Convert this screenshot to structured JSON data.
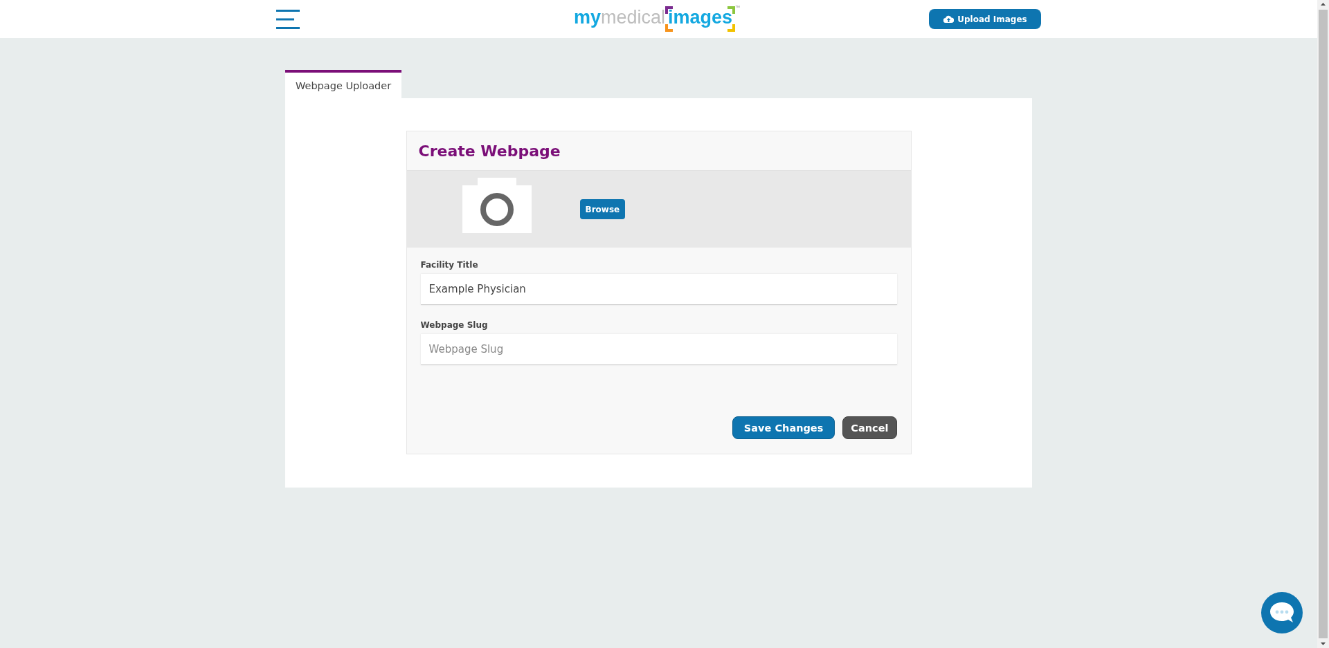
{
  "header": {
    "logo": {
      "parts": [
        "my",
        "medical",
        "images"
      ],
      "trademark": "™"
    },
    "upload_button": "Upload Images"
  },
  "tabs": [
    {
      "label": "Webpage Uploader",
      "selected": true
    }
  ],
  "card": {
    "title": "Create Webpage",
    "browse_button": "Browse",
    "fields": [
      {
        "label": "Facility Title",
        "value": "Example Physician"
      },
      {
        "label": "Webpage Slug",
        "placeholder": "Webpage Slug"
      }
    ],
    "buttons": [
      {
        "label": "Save Changes",
        "kind": "primary"
      },
      {
        "label": "Cancel",
        "kind": "secondary"
      }
    ]
  }
}
